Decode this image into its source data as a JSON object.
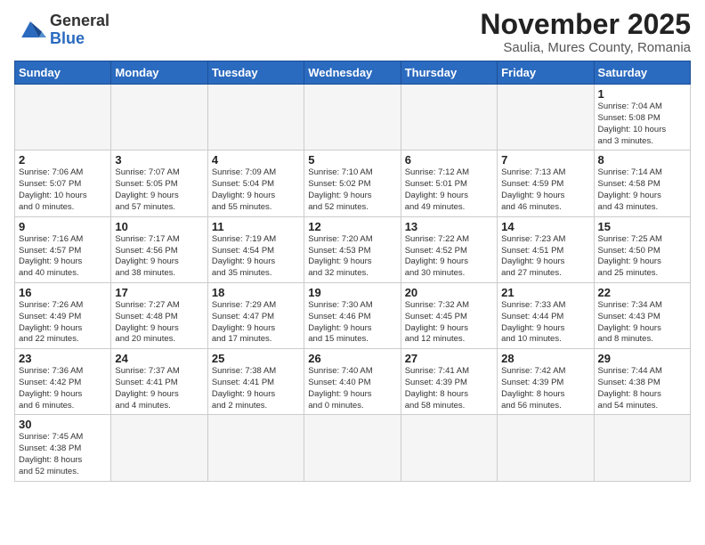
{
  "logo": {
    "text_general": "General",
    "text_blue": "Blue"
  },
  "header": {
    "month": "November 2025",
    "location": "Saulia, Mures County, Romania"
  },
  "weekdays": [
    "Sunday",
    "Monday",
    "Tuesday",
    "Wednesday",
    "Thursday",
    "Friday",
    "Saturday"
  ],
  "weeks": [
    [
      {
        "day": "",
        "info": ""
      },
      {
        "day": "",
        "info": ""
      },
      {
        "day": "",
        "info": ""
      },
      {
        "day": "",
        "info": ""
      },
      {
        "day": "",
        "info": ""
      },
      {
        "day": "",
        "info": ""
      },
      {
        "day": "1",
        "info": "Sunrise: 7:04 AM\nSunset: 5:08 PM\nDaylight: 10 hours\nand 3 minutes."
      }
    ],
    [
      {
        "day": "2",
        "info": "Sunrise: 7:06 AM\nSunset: 5:07 PM\nDaylight: 10 hours\nand 0 minutes."
      },
      {
        "day": "3",
        "info": "Sunrise: 7:07 AM\nSunset: 5:05 PM\nDaylight: 9 hours\nand 57 minutes."
      },
      {
        "day": "4",
        "info": "Sunrise: 7:09 AM\nSunset: 5:04 PM\nDaylight: 9 hours\nand 55 minutes."
      },
      {
        "day": "5",
        "info": "Sunrise: 7:10 AM\nSunset: 5:02 PM\nDaylight: 9 hours\nand 52 minutes."
      },
      {
        "day": "6",
        "info": "Sunrise: 7:12 AM\nSunset: 5:01 PM\nDaylight: 9 hours\nand 49 minutes."
      },
      {
        "day": "7",
        "info": "Sunrise: 7:13 AM\nSunset: 4:59 PM\nDaylight: 9 hours\nand 46 minutes."
      },
      {
        "day": "8",
        "info": "Sunrise: 7:14 AM\nSunset: 4:58 PM\nDaylight: 9 hours\nand 43 minutes."
      }
    ],
    [
      {
        "day": "9",
        "info": "Sunrise: 7:16 AM\nSunset: 4:57 PM\nDaylight: 9 hours\nand 40 minutes."
      },
      {
        "day": "10",
        "info": "Sunrise: 7:17 AM\nSunset: 4:56 PM\nDaylight: 9 hours\nand 38 minutes."
      },
      {
        "day": "11",
        "info": "Sunrise: 7:19 AM\nSunset: 4:54 PM\nDaylight: 9 hours\nand 35 minutes."
      },
      {
        "day": "12",
        "info": "Sunrise: 7:20 AM\nSunset: 4:53 PM\nDaylight: 9 hours\nand 32 minutes."
      },
      {
        "day": "13",
        "info": "Sunrise: 7:22 AM\nSunset: 4:52 PM\nDaylight: 9 hours\nand 30 minutes."
      },
      {
        "day": "14",
        "info": "Sunrise: 7:23 AM\nSunset: 4:51 PM\nDaylight: 9 hours\nand 27 minutes."
      },
      {
        "day": "15",
        "info": "Sunrise: 7:25 AM\nSunset: 4:50 PM\nDaylight: 9 hours\nand 25 minutes."
      }
    ],
    [
      {
        "day": "16",
        "info": "Sunrise: 7:26 AM\nSunset: 4:49 PM\nDaylight: 9 hours\nand 22 minutes."
      },
      {
        "day": "17",
        "info": "Sunrise: 7:27 AM\nSunset: 4:48 PM\nDaylight: 9 hours\nand 20 minutes."
      },
      {
        "day": "18",
        "info": "Sunrise: 7:29 AM\nSunset: 4:47 PM\nDaylight: 9 hours\nand 17 minutes."
      },
      {
        "day": "19",
        "info": "Sunrise: 7:30 AM\nSunset: 4:46 PM\nDaylight: 9 hours\nand 15 minutes."
      },
      {
        "day": "20",
        "info": "Sunrise: 7:32 AM\nSunset: 4:45 PM\nDaylight: 9 hours\nand 12 minutes."
      },
      {
        "day": "21",
        "info": "Sunrise: 7:33 AM\nSunset: 4:44 PM\nDaylight: 9 hours\nand 10 minutes."
      },
      {
        "day": "22",
        "info": "Sunrise: 7:34 AM\nSunset: 4:43 PM\nDaylight: 9 hours\nand 8 minutes."
      }
    ],
    [
      {
        "day": "23",
        "info": "Sunrise: 7:36 AM\nSunset: 4:42 PM\nDaylight: 9 hours\nand 6 minutes."
      },
      {
        "day": "24",
        "info": "Sunrise: 7:37 AM\nSunset: 4:41 PM\nDaylight: 9 hours\nand 4 minutes."
      },
      {
        "day": "25",
        "info": "Sunrise: 7:38 AM\nSunset: 4:41 PM\nDaylight: 9 hours\nand 2 minutes."
      },
      {
        "day": "26",
        "info": "Sunrise: 7:40 AM\nSunset: 4:40 PM\nDaylight: 9 hours\nand 0 minutes."
      },
      {
        "day": "27",
        "info": "Sunrise: 7:41 AM\nSunset: 4:39 PM\nDaylight: 8 hours\nand 58 minutes."
      },
      {
        "day": "28",
        "info": "Sunrise: 7:42 AM\nSunset: 4:39 PM\nDaylight: 8 hours\nand 56 minutes."
      },
      {
        "day": "29",
        "info": "Sunrise: 7:44 AM\nSunset: 4:38 PM\nDaylight: 8 hours\nand 54 minutes."
      }
    ],
    [
      {
        "day": "30",
        "info": "Sunrise: 7:45 AM\nSunset: 4:38 PM\nDaylight: 8 hours\nand 52 minutes."
      },
      {
        "day": "",
        "info": ""
      },
      {
        "day": "",
        "info": ""
      },
      {
        "day": "",
        "info": ""
      },
      {
        "day": "",
        "info": ""
      },
      {
        "day": "",
        "info": ""
      },
      {
        "day": "",
        "info": ""
      }
    ]
  ]
}
